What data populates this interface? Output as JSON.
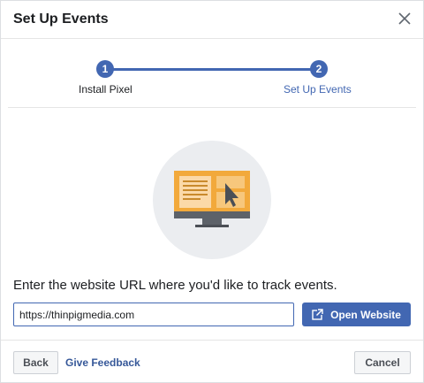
{
  "dialog": {
    "title": "Set Up Events",
    "close_icon": "close-icon"
  },
  "steps": [
    {
      "number": "1",
      "label": "Install Pixel"
    },
    {
      "number": "2",
      "label": "Set Up Events"
    }
  ],
  "illustration_icon": "monitor-cursor-illustration",
  "prompt": "Enter the website URL where you'd like to track events.",
  "url_input": {
    "value": "https://thinpigmedia.com"
  },
  "open_website": {
    "label": "Open Website",
    "icon": "external-link-icon"
  },
  "footer": {
    "back_label": "Back",
    "feedback_label": "Give Feedback",
    "cancel_label": "Cancel"
  },
  "colors": {
    "accent": "#4267b2",
    "link": "#365899",
    "illustration_circle": "#ebedf0",
    "monitor_orange": "#f2a93b"
  }
}
